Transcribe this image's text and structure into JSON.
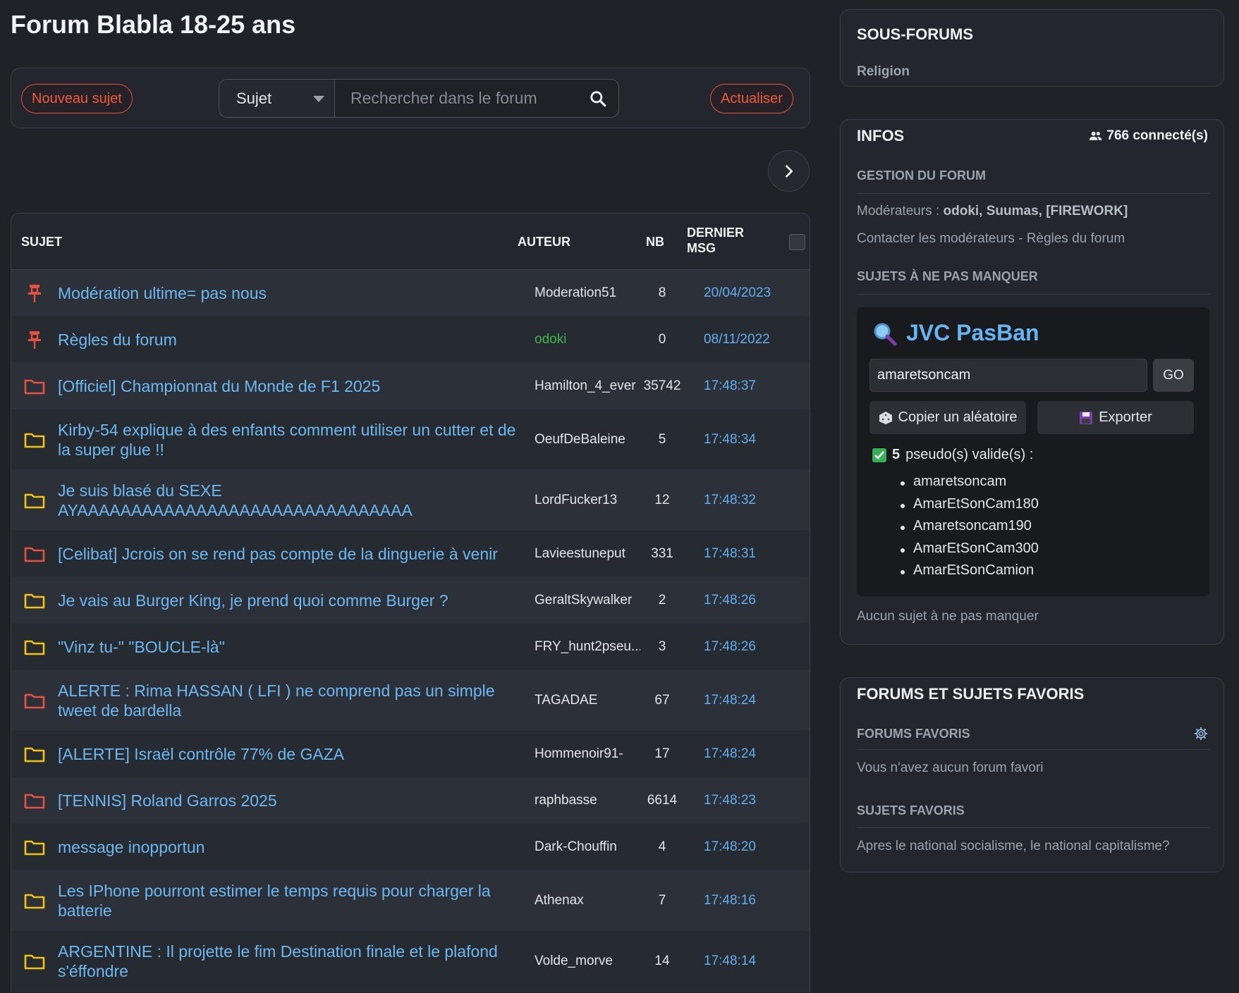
{
  "page": {
    "title": "Forum Blabla 18-25 ans"
  },
  "toolbar": {
    "new_topic": "Nouveau sujet",
    "search_scope": "Sujet",
    "search_placeholder": "Rechercher dans le forum",
    "refresh": "Actualiser"
  },
  "table": {
    "headers": {
      "subject": "SUJET",
      "author": "AUTEUR",
      "count": "NB",
      "last_line1": "DERNIER",
      "last_line2": "MSG"
    },
    "rows": [
      {
        "icon": "pin-icon",
        "title": "Modération ultime= pas nous",
        "author": "Moderation51",
        "count": "8",
        "last": "20/04/2023"
      },
      {
        "icon": "pin-icon",
        "title": "Règles du forum",
        "author": "odoki",
        "count": "0",
        "last": "08/11/2022"
      },
      {
        "icon": "folder-red-icon",
        "title": "[Officiel] Championnat du Monde de F1 2025",
        "author": "Hamilton_4_ever",
        "count": "35742",
        "last": "17:48:37"
      },
      {
        "icon": "folder-yellow-icon",
        "title": "Kirby-54 explique à des enfants comment utiliser un cutter et de la super glue !!",
        "author": "OeufDeBaleine",
        "count": "5",
        "last": "17:48:34"
      },
      {
        "icon": "folder-yellow-icon",
        "title": "Je suis blasé du SEXE AYAAAAAAAAAAAAAAAAAAAAAAAAAAAAAAA",
        "author": "LordFucker13",
        "count": "12",
        "last": "17:48:32"
      },
      {
        "icon": "folder-red-icon",
        "title": "[Celibat] Jcrois on se rend pas compte de la dinguerie à venir",
        "author": "Lavieestuneput",
        "count": "331",
        "last": "17:48:31"
      },
      {
        "icon": "folder-yellow-icon",
        "title": "Je vais au Burger King, je prend quoi comme Burger ?",
        "author": "GeraltSkywalker",
        "count": "2",
        "last": "17:48:26"
      },
      {
        "icon": "folder-yellow-icon",
        "title": "\"Vinz tu-\" \"BOUCLE-là\"",
        "author": "FRY_hunt2pseu...",
        "count": "3",
        "last": "17:48:26"
      },
      {
        "icon": "folder-red-icon",
        "title": "ALERTE : Rima HASSAN ( LFI ) ne comprend pas un simple tweet de bardella",
        "author": "TAGADAE",
        "count": "67",
        "last": "17:48:24"
      },
      {
        "icon": "folder-yellow-icon",
        "title": "[ALERTE] Israël contrôle 77% de GAZA",
        "author": "Hommenoir91-",
        "count": "17",
        "last": "17:48:24"
      },
      {
        "icon": "folder-red-icon",
        "title": "[TENNIS] Roland Garros 2025",
        "author": "raphbasse",
        "count": "6614",
        "last": "17:48:23"
      },
      {
        "icon": "folder-yellow-icon",
        "title": "message inopportun",
        "author": "Dark-Chouffin",
        "count": "4",
        "last": "17:48:20"
      },
      {
        "icon": "folder-yellow-icon",
        "title": "Les IPhone pourront estimer le temps requis pour charger la batterie",
        "author": "Athenax",
        "count": "7",
        "last": "17:48:16"
      },
      {
        "icon": "folder-yellow-icon",
        "title": "ARGENTINE : Il projette le fim Destination finale et le plafond s'éffondre",
        "author": "Volde_morve",
        "count": "14",
        "last": "17:48:14"
      }
    ]
  },
  "sidebar": {
    "subforums": {
      "title": "SOUS-FORUMS",
      "items": [
        "Religion"
      ]
    },
    "infos": {
      "title": "INFOS",
      "online": "766 connecté(s)",
      "management_title": "GESTION DU FORUM",
      "moderators_label": "Modérateurs : ",
      "moderators": "odoki, Suumas, [FIREWORK]",
      "contact_mods": "Contacter les modérateurs",
      "separator": " - ",
      "rules": "Règles du forum",
      "must_read_title": "SUJETS À NE PAS MANQUER",
      "no_must_read": "Aucun sujet à ne pas manquer"
    },
    "pasban": {
      "title": "JVC PasBan",
      "input_value": "amaretsoncam",
      "go": "GO",
      "copy_random": "Copier un aléatoire",
      "export": "Exporter",
      "valid_count": "5",
      "valid_label": "pseudo(s) valide(s) :",
      "pseudos": [
        "amaretsoncam",
        "AmarEtSonCam180",
        "Amaretsoncam190",
        "AmarEtSonCam300",
        "AmarEtSonCamion"
      ]
    },
    "favorites": {
      "title": "FORUMS ET SUJETS FAVORIS",
      "forums_title": "FORUMS FAVORIS",
      "no_forums": "Vous n'avez aucun forum favori",
      "topics_title": "SUJETS FAVORIS",
      "topics": [
        "Apres le national socialisme, le national capitalisme?"
      ]
    }
  },
  "colors": {
    "accent_orange": "#ef5a3d",
    "link_blue": "#6cb8f2",
    "folder_red": "#e8503f",
    "folder_yellow": "#f2c40f",
    "mod_green": "#40b84a"
  }
}
